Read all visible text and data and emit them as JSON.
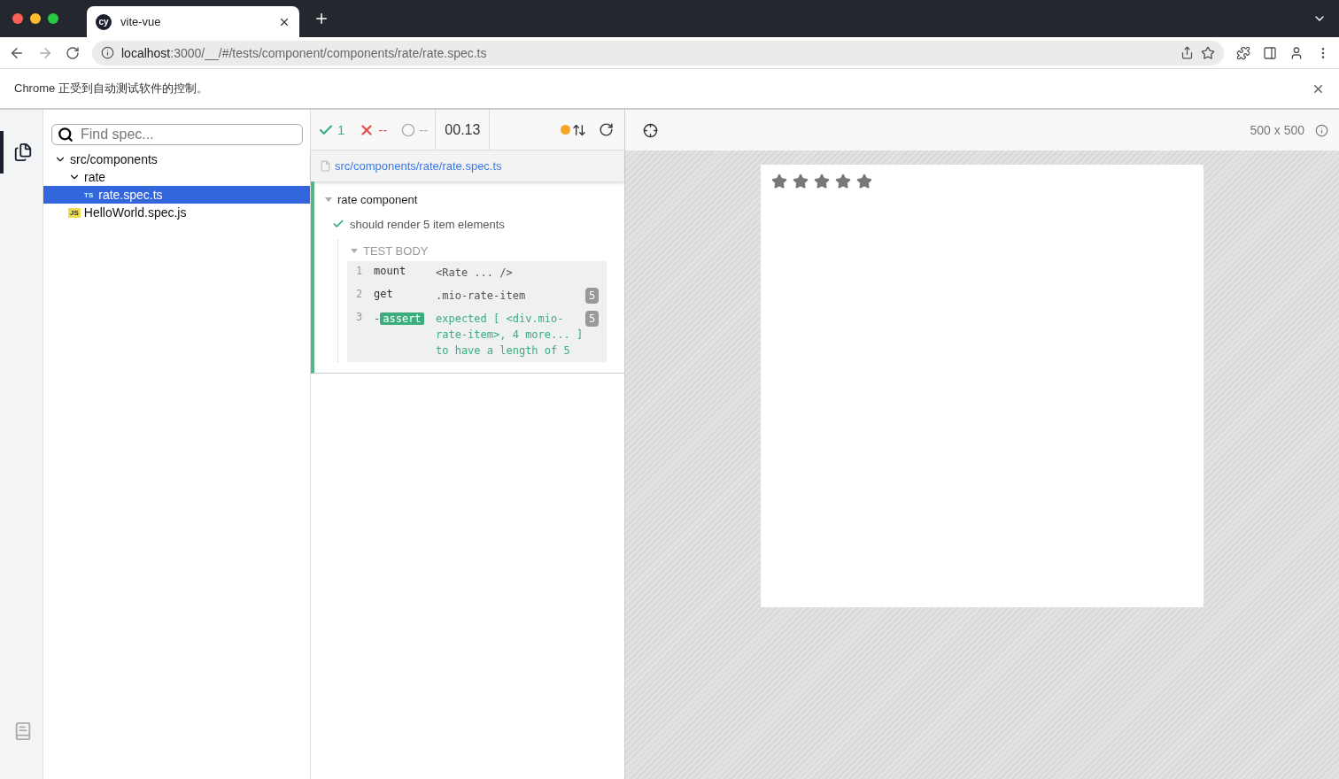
{
  "browser": {
    "tabs": [
      {
        "title": "vite-vue",
        "logo": "cy",
        "selected": true
      }
    ],
    "url": "**localhost**:3000/__/#/tests/component/components/rate/rate.spec.ts",
    "infobar": "Chrome 正受到自动测试软件的控制。"
  },
  "sidebar": {
    "items": [
      {
        "kind": "specs",
        "selected": true
      },
      {
        "kind": "docs",
        "selected": false
      }
    ]
  },
  "specs": {
    "search": {
      "placeholder": "Find spec..."
    },
    "tree": [
      {
        "kind": "folder",
        "label": "src/components",
        "expanded": true,
        "selected": false,
        "children": [
          {
            "kind": "folder",
            "label": "rate",
            "expanded": true,
            "selected": false,
            "children": [
              {
                "kind": "file",
                "label": "rate.spec.ts",
                "badge": "TS",
                "selected": true
              }
            ]
          },
          {
            "kind": "file",
            "label": "HelloWorld.spec.js",
            "badge": "JS",
            "selected": false
          }
        ]
      }
    ]
  },
  "reporter": {
    "stats": {
      "passed": "1",
      "failed": "--",
      "pending": "--",
      "duration": "00.13"
    },
    "auto_scroll": true,
    "file": "src/components/rate/rate.spec.ts",
    "suite": {
      "title": "rate component",
      "expanded": true
    },
    "test": {
      "title": "should render 5 item elements",
      "passed": true
    },
    "section": {
      "title": "TEST BODY",
      "expanded": true
    },
    "commands": [
      {
        "kind": "command",
        "number": "1",
        "name": "mount",
        "message": "<Rate ... />"
      },
      {
        "kind": "command",
        "number": "2",
        "name": "get",
        "message": ".mio-rate-item",
        "count": "5"
      },
      {
        "kind": "assert",
        "number": "3",
        "prefix": "-",
        "name": "assert",
        "message": "expected [ <div.mio-rate-item>, 4 more... ] to have a length of 5",
        "count": "5"
      }
    ]
  },
  "preview": {
    "viewport": "500 x 500",
    "rate": {
      "stars": 5
    }
  }
}
